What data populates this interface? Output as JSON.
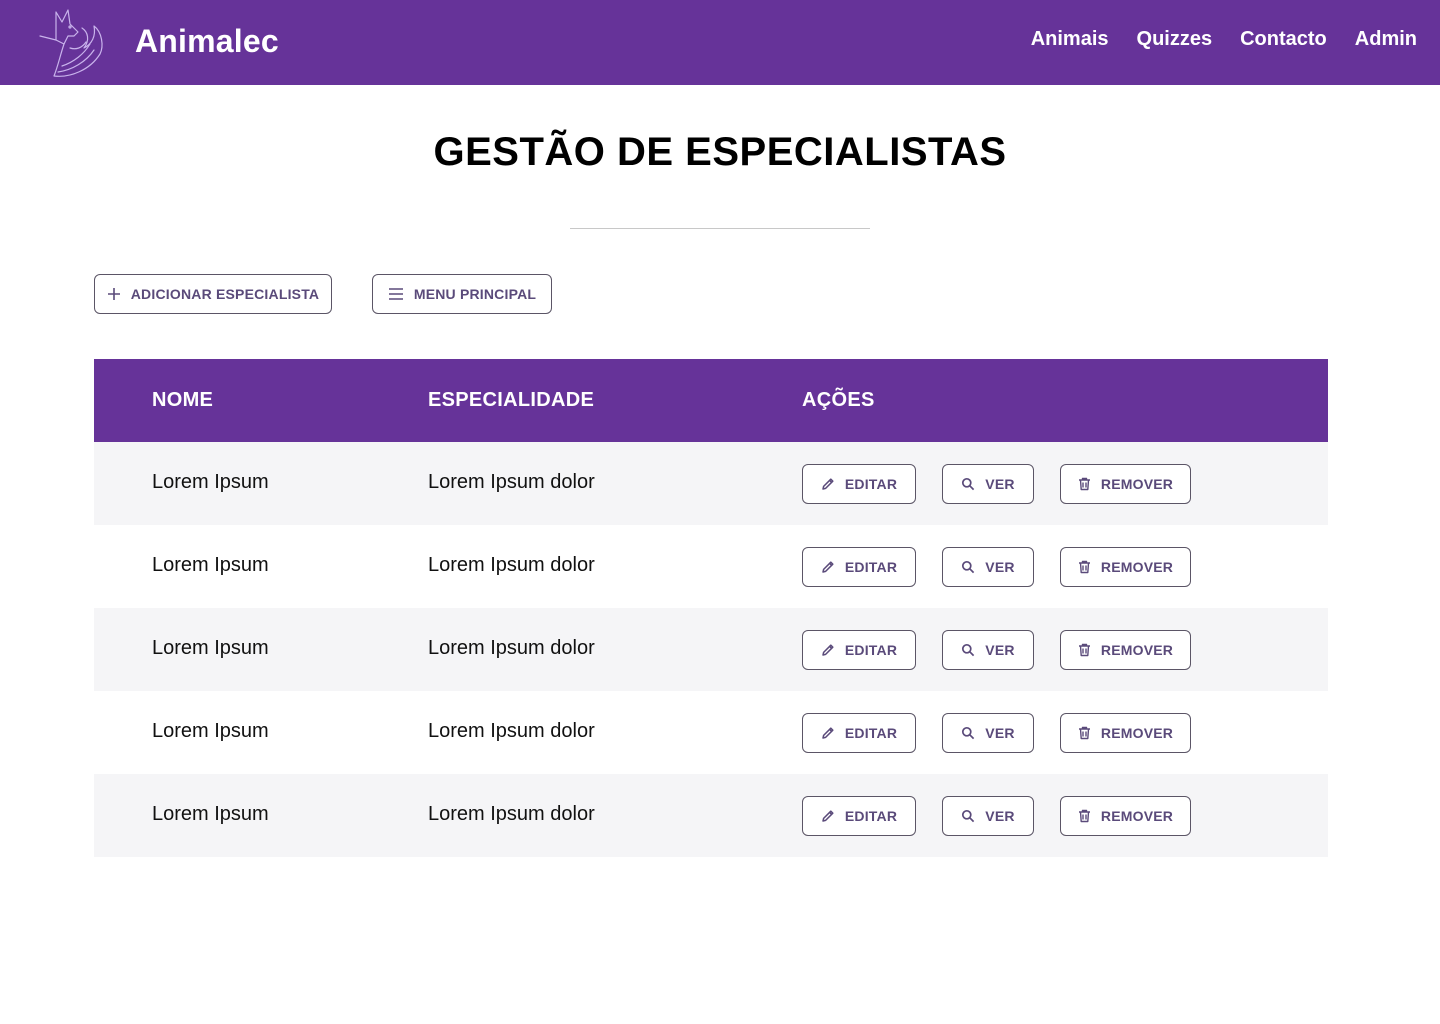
{
  "header": {
    "brand": "Animalec",
    "nav": [
      "Animais",
      "Quizzes",
      "Contacto",
      "Admin"
    ],
    "accent_color": "#663399"
  },
  "page": {
    "title": "GESTÃO DE ESPECIALISTAS"
  },
  "toolbar": {
    "add_label": "ADICIONAR ESPECIALISTA",
    "add_icon": "plus-icon",
    "menu_label": "MENU PRINCIPAL",
    "menu_icon": "hamburger-icon"
  },
  "table": {
    "headers": [
      "NOME",
      "ESPECIALIDADE",
      "AÇÕES"
    ],
    "action_labels": {
      "edit": "EDITAR",
      "view": "VER",
      "remove": "REMOVER"
    },
    "action_icons": {
      "edit": "pencil-icon",
      "view": "search-icon",
      "remove": "trash-icon"
    },
    "rows": [
      {
        "nome": "Lorem Ipsum",
        "especialidade": "Lorem Ipsum dolor"
      },
      {
        "nome": "Lorem Ipsum",
        "especialidade": "Lorem Ipsum dolor"
      },
      {
        "nome": "Lorem Ipsum",
        "especialidade": "Lorem Ipsum dolor"
      },
      {
        "nome": "Lorem Ipsum",
        "especialidade": "Lorem Ipsum dolor"
      },
      {
        "nome": "Lorem Ipsum",
        "especialidade": "Lorem Ipsum dolor"
      }
    ]
  }
}
